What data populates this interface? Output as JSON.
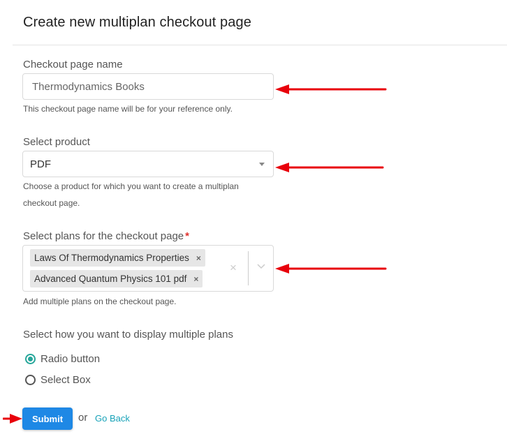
{
  "page": {
    "title": "Create new multiplan checkout page"
  },
  "checkout_name": {
    "label": "Checkout page name",
    "value": "Thermodynamics Books",
    "help": "This checkout page name will be for your reference only."
  },
  "product": {
    "label": "Select product",
    "selected": "PDF",
    "help": "Choose a product for which you want to create a multiplan checkout page."
  },
  "plans": {
    "label": "Select plans for the checkout page",
    "required_marker": "*",
    "selected": [
      {
        "label": "Laws Of Thermodynamics Properties",
        "remove": "×"
      },
      {
        "label": "Advanced Quantum Physics 101 pdf",
        "remove": "×"
      }
    ],
    "clear_icon": "×",
    "help": "Add multiple plans on the checkout page."
  },
  "display_mode": {
    "label": "Select how you want to display multiple plans",
    "options": [
      {
        "label": "Radio button",
        "checked": true
      },
      {
        "label": "Select Box",
        "checked": false
      }
    ]
  },
  "actions": {
    "submit": "Submit",
    "or": "or",
    "go_back": "Go Back"
  },
  "annotations": {
    "arrow_color": "#e8000b"
  }
}
